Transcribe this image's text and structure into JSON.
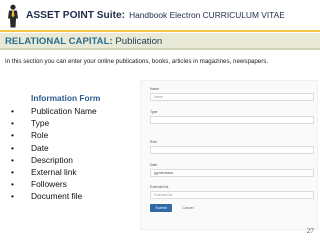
{
  "header": {
    "title_main": "ASSET POINT Suite:",
    "title_sub": "Handbook Electron CURRICULUM VITAE"
  },
  "section": {
    "prefix": "RELATIONAL CAPITAL:",
    "name": "Publication"
  },
  "intro": "In this section you can enter your online publications, books, articles in magazines, newspapers.",
  "info": {
    "heading": "Information Form",
    "bullet": "•",
    "items": [
      "Publication Name",
      "Type",
      "Role",
      "Date",
      "Description",
      "External link",
      "Followers",
      "Document file"
    ]
  },
  "form": {
    "name_label": "Name",
    "name_placeholder": "Name",
    "type_label": "Type",
    "role_label": "Role",
    "date_label": "Date",
    "date_value": "gg/mm/aaaa",
    "link_label": "External link",
    "link_placeholder": "External link",
    "submit_label": "Submit",
    "cancel_label": "Cancel"
  },
  "page_number": "27",
  "colors": {
    "accent_line": "#f3c445",
    "section_bg": "#e8e9d6",
    "heading_blue": "#2b5c8c",
    "submit_blue": "#2e6aa3"
  }
}
